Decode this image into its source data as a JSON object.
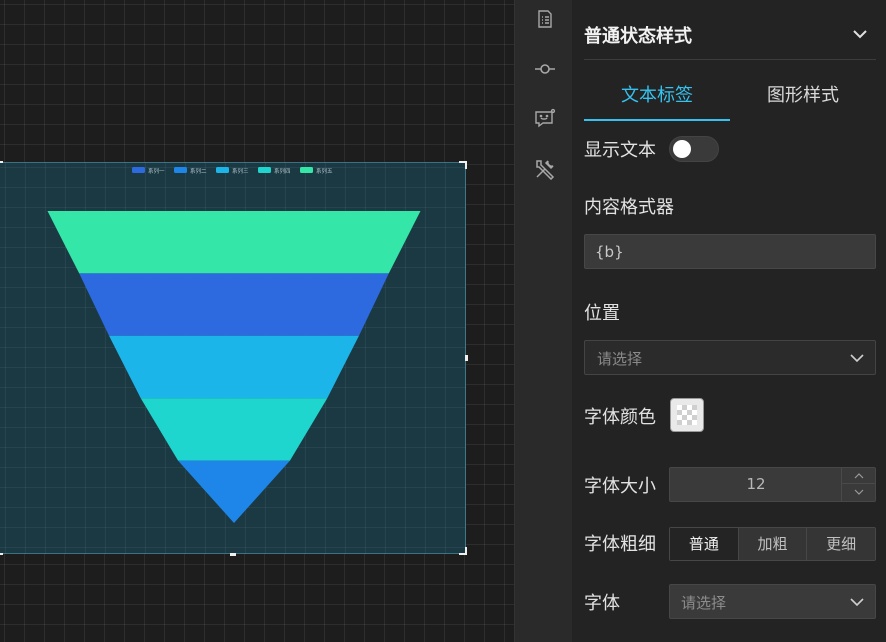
{
  "panel": {
    "title": "普通状态样式",
    "tabs": [
      {
        "label": "文本标签",
        "active": true
      },
      {
        "label": "图形样式",
        "active": false
      }
    ],
    "show_text": {
      "label": "显示文本",
      "enabled": false
    },
    "formatter": {
      "label": "内容格式器",
      "value": "{b}"
    },
    "position": {
      "label": "位置",
      "placeholder": "请选择"
    },
    "font_color": {
      "label": "字体颜色"
    },
    "font_size": {
      "label": "字体大小",
      "value": "12"
    },
    "font_weight": {
      "label": "字体粗细",
      "options": [
        "普通",
        "加粗",
        "更细"
      ],
      "selected": "普通"
    },
    "font_family": {
      "label": "字体",
      "placeholder": "请选择"
    }
  },
  "icons": [
    "list-icon",
    "commit-icon",
    "comment-icon",
    "tools-icon"
  ],
  "colors": {
    "accent": "#35c2f0",
    "panel_bg": "#232323",
    "canvas_bg": "#1d1d1d"
  },
  "chart_data": {
    "type": "funnel",
    "legend_position": "top-center",
    "series": [
      {
        "name": "系列一",
        "color": "#2d6ae0"
      },
      {
        "name": "系列二",
        "color": "#1e86e8"
      },
      {
        "name": "系列三",
        "color": "#1cb5ea"
      },
      {
        "name": "系列四",
        "color": "#1fd6cf"
      },
      {
        "name": "系列五",
        "color": "#34e6a8"
      }
    ],
    "stages": [
      {
        "color": "#34e6a8",
        "value": 100
      },
      {
        "color": "#2d6ae0",
        "value": 83
      },
      {
        "color": "#1cb5ea",
        "value": 67
      },
      {
        "color": "#1fd6cf",
        "value": 50
      },
      {
        "color": "#1e86e8",
        "value": 30
      }
    ]
  }
}
